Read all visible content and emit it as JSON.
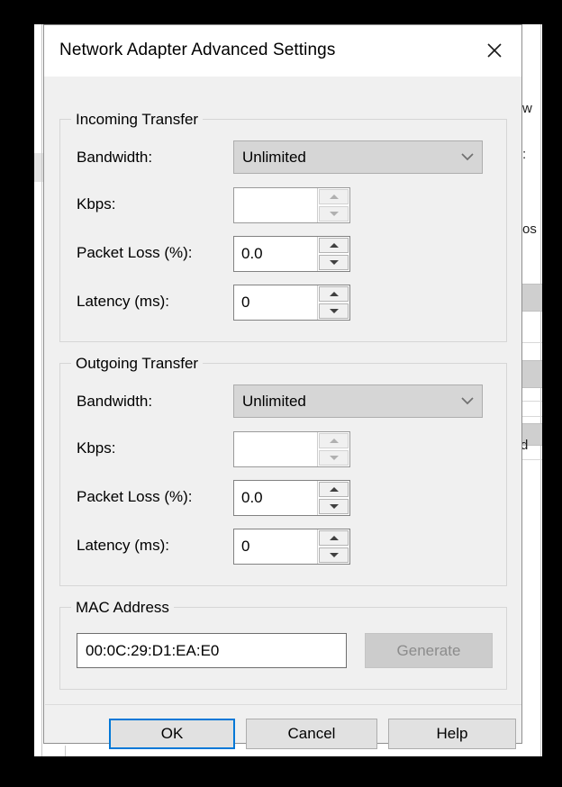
{
  "background": {
    "fragments": [
      "w",
      ":",
      "os",
      "d"
    ]
  },
  "dialog": {
    "title": "Network Adapter Advanced Settings",
    "close_icon": "close-icon"
  },
  "incoming": {
    "legend": "Incoming Transfer",
    "bandwidth": {
      "label": "Bandwidth:",
      "value": "Unlimited",
      "icon": "chevron-down-icon",
      "disabled": true
    },
    "kbps": {
      "label": "Kbps:",
      "value": "",
      "disabled": true
    },
    "packet_loss": {
      "label": "Packet Loss (%):",
      "value": "0.0",
      "disabled": false
    },
    "latency": {
      "label": "Latency (ms):",
      "value": "0",
      "disabled": false
    }
  },
  "outgoing": {
    "legend": "Outgoing Transfer",
    "bandwidth": {
      "label": "Bandwidth:",
      "value": "Unlimited",
      "icon": "chevron-down-icon",
      "disabled": true
    },
    "kbps": {
      "label": "Kbps:",
      "value": "",
      "disabled": true
    },
    "packet_loss": {
      "label": "Packet Loss (%):",
      "value": "0.0",
      "disabled": false
    },
    "latency": {
      "label": "Latency (ms):",
      "value": "0",
      "disabled": false
    }
  },
  "mac": {
    "legend": "MAC Address",
    "value": "00:0C:29:D1:EA:E0",
    "generate_label": "Generate",
    "generate_disabled": true
  },
  "footer": {
    "ok_label": "OK",
    "cancel_label": "Cancel",
    "help_label": "Help",
    "focus_color": "#0078D7"
  }
}
